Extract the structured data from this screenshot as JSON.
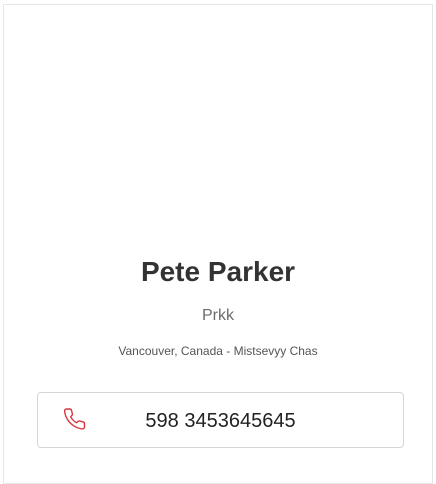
{
  "profile": {
    "name": "Pete Parker",
    "subtitle": "Prkk",
    "location": "Vancouver, Canada - Mistsevyy Chas"
  },
  "contact": {
    "phone": "598 3453645645",
    "icon": "phone-icon",
    "icon_color": "#d9363e"
  }
}
